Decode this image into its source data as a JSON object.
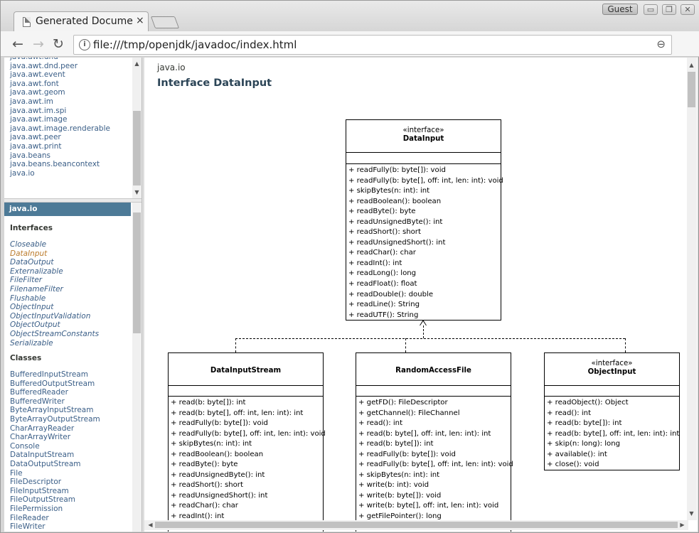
{
  "browser": {
    "tab_title": "Generated Documen",
    "tab_close": "×",
    "profile": "Guest",
    "url": "file:///tmp/openjdk/javadoc/index.html",
    "win_min": "▭",
    "win_max": "❐",
    "win_close": "✕",
    "back": "←",
    "forward": "→",
    "reload": "↻",
    "info": "i",
    "zoom": "⊖",
    "menu": "⋮"
  },
  "package_frame": {
    "items": [
      "java.awt.dnd",
      "java.awt.dnd.peer",
      "java.awt.event",
      "java.awt.font",
      "java.awt.geom",
      "java.awt.im",
      "java.awt.im.spi",
      "java.awt.image",
      "java.awt.image.renderable",
      "java.awt.peer",
      "java.awt.print",
      "java.beans",
      "java.beans.beancontext",
      "java.io"
    ]
  },
  "class_frame": {
    "package": "java.io",
    "interfaces_heading": "Interfaces",
    "interfaces": [
      "Closeable",
      "DataInput",
      "DataOutput",
      "Externalizable",
      "FileFilter",
      "FilenameFilter",
      "Flushable",
      "ObjectInput",
      "ObjectInputValidation",
      "ObjectOutput",
      "ObjectStreamConstants",
      "Serializable"
    ],
    "classes_heading": "Classes",
    "classes": [
      "BufferedInputStream",
      "BufferedOutputStream",
      "BufferedReader",
      "BufferedWriter",
      "ByteArrayInputStream",
      "ByteArrayOutputStream",
      "CharArrayReader",
      "CharArrayWriter",
      "Console",
      "DataInputStream",
      "DataOutputStream",
      "File",
      "FileDescriptor",
      "FileInputStream",
      "FileOutputStream",
      "FilePermission",
      "FileReader",
      "FileWriter"
    ]
  },
  "main": {
    "package": "java.io",
    "title": "Interface DataInput",
    "uml": {
      "datainput": {
        "stereotype": "«interface»",
        "name": "DataInput",
        "ops": [
          "+ readFully(b: byte[]): void",
          "+ readFully(b: byte[], off: int, len: int): void",
          "+ skipBytes(n: int): int",
          "+ readBoolean(): boolean",
          "+ readByte(): byte",
          "+ readUnsignedByte(): int",
          "+ readShort(): short",
          "+ readUnsignedShort(): int",
          "+ readChar(): char",
          "+ readInt(): int",
          "+ readLong(): long",
          "+ readFloat(): float",
          "+ readDouble(): double",
          "+ readLine(): String",
          "+ readUTF(): String"
        ]
      },
      "datainputstream": {
        "name": "DataInputStream",
        "ops": [
          "+ read(b: byte[]): int",
          "+ read(b: byte[], off: int, len: int): int",
          "+ readFully(b: byte[]): void",
          "+ readFully(b: byte[], off: int, len: int): void",
          "+ skipBytes(n: int): int",
          "+ readBoolean(): boolean",
          "+ readByte(): byte",
          "+ readUnsignedByte(): int",
          "+ readShort(): short",
          "+ readUnsignedShort(): int",
          "+ readChar(): char",
          "+ readInt(): int"
        ]
      },
      "randomaccessfile": {
        "name": "RandomAccessFile",
        "ops": [
          "+ getFD(): FileDescriptor",
          "+ getChannel(): FileChannel",
          "+ read(): int",
          "+ read(b: byte[], off: int, len: int): int",
          "+ read(b: byte[]): int",
          "+ readFully(b: byte[]): void",
          "+ readFully(b: byte[], off: int, len: int): void",
          "+ skipBytes(n: int): int",
          "+ write(b: int): void",
          "+ write(b: byte[]): void",
          "+ write(b: byte[], off: int, len: int): void",
          "+ getFilePointer(): long"
        ]
      },
      "objectinput": {
        "stereotype": "«interface»",
        "name": "ObjectInput",
        "ops": [
          "+ readObject(): Object",
          "+ read(): int",
          "+ read(b: byte[]): int",
          "+ read(b: byte[], off: int, len: int): int",
          "+ skip(n: long): long",
          "+ available(): int",
          "+ close(): void"
        ]
      }
    }
  }
}
